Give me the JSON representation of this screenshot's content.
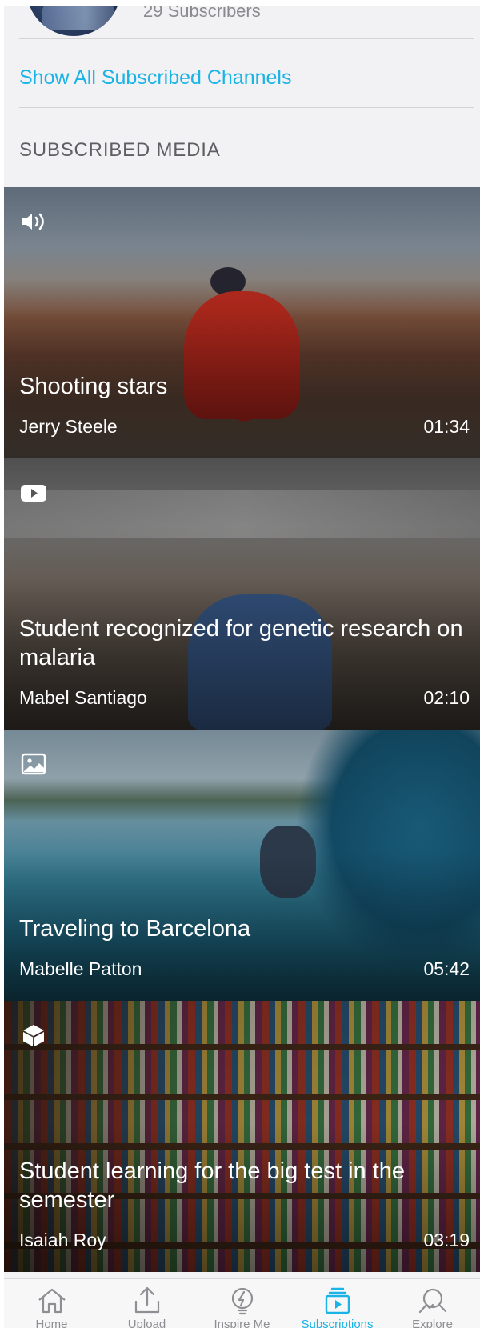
{
  "channel": {
    "subscribers": "29 Subscribers"
  },
  "show_all_label": "Show All Subscribed Channels",
  "section_title": "SUBSCRIBED MEDIA",
  "media": [
    {
      "type_icon": "speaker-icon",
      "title": "Shooting stars",
      "author": "Jerry Steele",
      "duration": "01:34"
    },
    {
      "type_icon": "video-play-icon",
      "title": "Student recognized for genetic research on malaria",
      "author": "Mabel Santiago",
      "duration": "02:10"
    },
    {
      "type_icon": "image-icon",
      "title": "Traveling to Barcelona",
      "author": "Mabelle Patton",
      "duration": "05:42"
    },
    {
      "type_icon": "cube-icon",
      "title": "Student learning for the big test in the semester",
      "author": "Isaiah Roy",
      "duration": "03:19"
    }
  ],
  "tabs": [
    {
      "label": "Home",
      "icon": "home-icon",
      "active": false
    },
    {
      "label": "Upload",
      "icon": "upload-icon",
      "active": false
    },
    {
      "label": "Inspire Me",
      "icon": "lightbulb-icon",
      "active": false
    },
    {
      "label": "Subscriptions",
      "icon": "subscriptions-icon",
      "active": true
    },
    {
      "label": "Explore",
      "icon": "explore-search-icon",
      "active": false
    }
  ],
  "colors": {
    "accent": "#19b3e6",
    "background": "#f2f2f4",
    "muted_text": "#8a8a8e"
  }
}
